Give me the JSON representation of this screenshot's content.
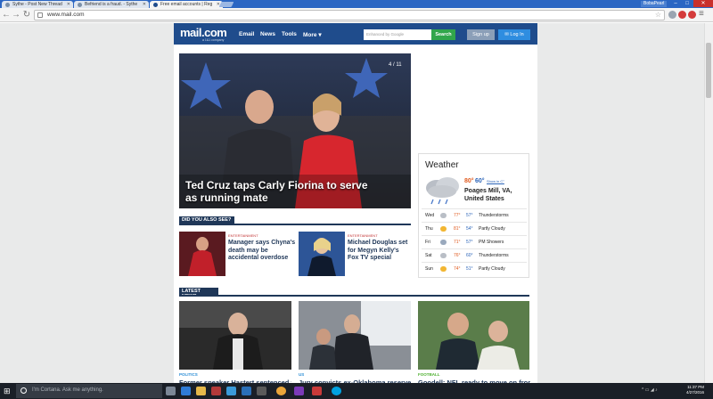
{
  "browser": {
    "tabs": [
      {
        "label": "Sythe - Post New Thread",
        "active": false
      },
      {
        "label": "Befriend is a fraud. - Sythe",
        "active": false
      },
      {
        "label": "Free email accounts | Reg",
        "active": true
      }
    ],
    "user_label": "BobaPearl",
    "url": "www.mail.com"
  },
  "site": {
    "logo": "mail.com",
    "logo_sub": "a 1&1 company",
    "nav": [
      "Email",
      "News",
      "Tools",
      "More"
    ],
    "search_placeholder": "Enhanced by Google",
    "search_button": "Search",
    "signup_button": "Sign up",
    "login_button": "Log In"
  },
  "hero": {
    "headline": "Ted Cruz taps Carly Fiorina to serve as running mate",
    "counter": "4 / 11"
  },
  "also_see": {
    "title": "DID YOU ALSO SEE?",
    "items": [
      {
        "tag": "ENTERTAINMENT",
        "title": "Manager says Chyna's death may be accidental overdose"
      },
      {
        "tag": "ENTERTAINMENT",
        "title": "Michael Douglas set for Megyn Kelly's Fox TV special"
      }
    ]
  },
  "weather": {
    "title": "Weather",
    "hi": "80°",
    "lo": "60°",
    "link": "Show in C°",
    "location": "Poages Mill, VA, United States",
    "forecast": [
      {
        "day": "Wed",
        "hi": "77°",
        "lo": "57°",
        "desc": "Thunderstorms"
      },
      {
        "day": "Thu",
        "hi": "81°",
        "lo": "54°",
        "desc": "Partly Cloudy"
      },
      {
        "day": "Fri",
        "hi": "71°",
        "lo": "57°",
        "desc": "PM Showers"
      },
      {
        "day": "Sat",
        "hi": "76°",
        "lo": "60°",
        "desc": "Thunderstorms"
      },
      {
        "day": "Sun",
        "hi": "74°",
        "lo": "51°",
        "desc": "Partly Cloudy"
      }
    ]
  },
  "latest": {
    "title": "LATEST NEWS",
    "items": [
      {
        "category": "POLITICS",
        "title": "Former speaker Hastert sentenced to",
        "color": "#2a8dd6"
      },
      {
        "category": "US",
        "title": "Jury convicts ex-Oklahoma reserve",
        "color": "#2a8dd6"
      },
      {
        "category": "FOOTBALL",
        "title": "Goodell: NFL ready to move on from",
        "color": "#4caf2e"
      }
    ]
  },
  "taskbar": {
    "cortana": "I'm Cortana. Ask me anything.",
    "time": "11:37 PM",
    "date": "4/27/2016"
  }
}
